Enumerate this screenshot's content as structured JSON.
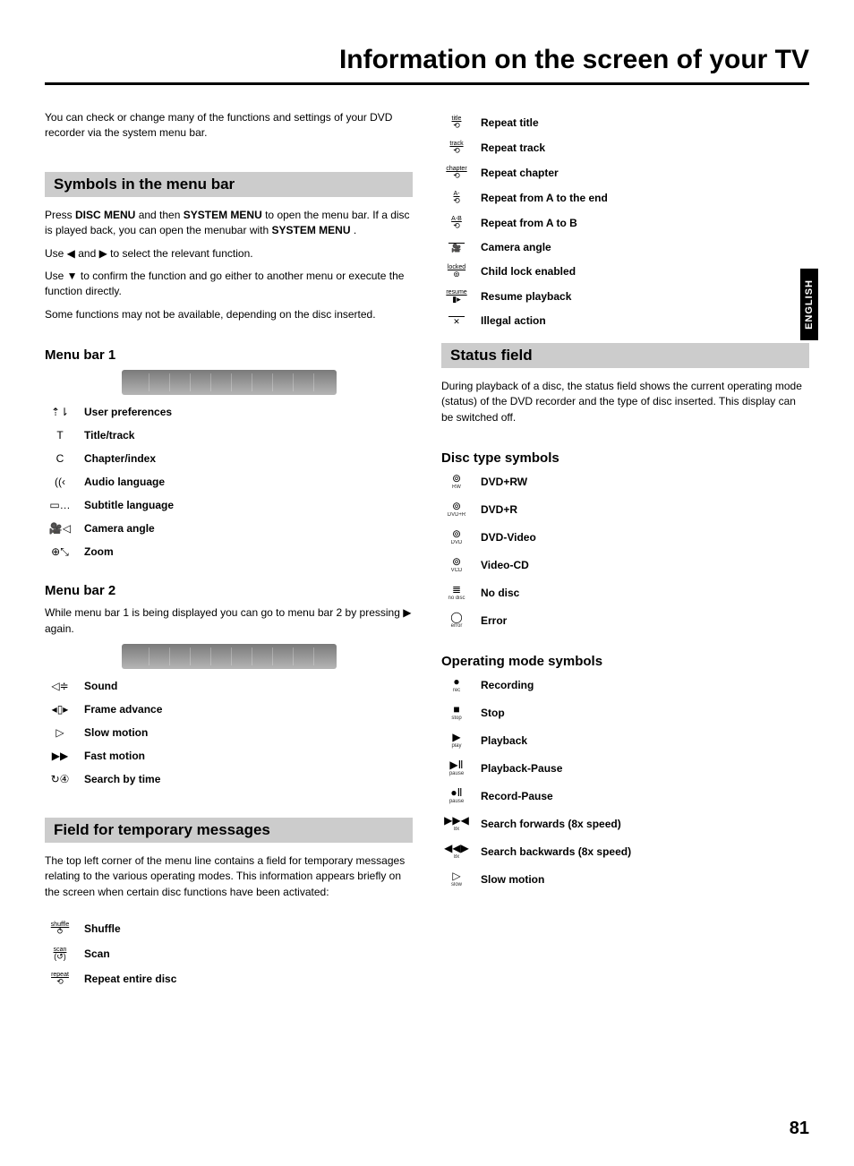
{
  "page_title": "Information on the screen of your TV",
  "side_tab": "ENGLISH",
  "page_number": "81",
  "intro": "You can check or change many of the functions and settings of your DVD recorder via the system menu bar.",
  "section_symbols_title": "Symbols in the menu bar",
  "symbols_para1_a": "Press ",
  "symbols_para1_b": " and then ",
  "symbols_para1_c": " to open the menu bar. If a disc is played back, you can open the menubar with ",
  "symbols_para1_d": " .",
  "kw_disc_menu": " DISC MENU",
  "kw_system_menu": " SYSTEM MENU",
  "kw_system_menu2": " SYSTEM MENU",
  "symbols_para2": "Use  ◀  and  ▶  to select the relevant function.",
  "symbols_para3": "Use  ▼  to confirm the function and go either to another menu or execute the function directly.",
  "symbols_para4": "Some functions may not be available, depending on the disc inserted.",
  "menu_bar1_heading": "Menu bar 1",
  "menu_bar1_items": [
    {
      "icon_top": "",
      "icon_glyph": "⇡⇂",
      "icon_sub": "",
      "label": "User preferences"
    },
    {
      "icon_top": "",
      "icon_glyph": "T",
      "icon_sub": "",
      "label": "Title/track"
    },
    {
      "icon_top": "",
      "icon_glyph": "C",
      "icon_sub": "",
      "label": "Chapter/index"
    },
    {
      "icon_top": "",
      "icon_glyph": "((‹",
      "icon_sub": "",
      "label": "Audio language"
    },
    {
      "icon_top": "",
      "icon_glyph": "▭…",
      "icon_sub": "",
      "label": "Subtitle language"
    },
    {
      "icon_top": "",
      "icon_glyph": "🎥◁",
      "icon_sub": "",
      "label": "Camera angle"
    },
    {
      "icon_top": "",
      "icon_glyph": "⊕⤡",
      "icon_sub": "",
      "label": "Zoom"
    }
  ],
  "menu_bar2_heading": "Menu bar 2",
  "menu_bar2_intro": "While menu bar 1 is being displayed you can go to menu bar 2 by pressing  ▶  again.",
  "menu_bar2_items": [
    {
      "icon_top": "",
      "icon_glyph": "◁≑",
      "icon_sub": "",
      "label": "Sound"
    },
    {
      "icon_top": "",
      "icon_glyph": "◂▯▸",
      "icon_sub": "",
      "label": "Frame advance"
    },
    {
      "icon_top": "",
      "icon_glyph": "▷",
      "icon_sub": "",
      "label": "Slow motion"
    },
    {
      "icon_top": "",
      "icon_glyph": "▶▶",
      "icon_sub": "",
      "label": "Fast motion"
    },
    {
      "icon_top": "",
      "icon_glyph": "↻④",
      "icon_sub": "",
      "label": "Search by time"
    }
  ],
  "field_temp_title": "Field for temporary messages",
  "field_temp_intro": "The top left corner of the menu line contains a field for temporary messages relating to the various operating modes. This information appears briefly on the screen when certain disc functions have been activated:",
  "temp_messages_left": [
    {
      "top": "shuffle",
      "bot": "⥀",
      "label": "Shuffle"
    },
    {
      "top": "scan",
      "bot": "(↺)",
      "label": "Scan"
    },
    {
      "top": "repeat",
      "bot": "⟲",
      "label": "Repeat entire disc"
    }
  ],
  "temp_messages_right": [
    {
      "top": "title",
      "bot": "⟲",
      "label": "Repeat title"
    },
    {
      "top": "track",
      "bot": "⟲",
      "label": "Repeat track"
    },
    {
      "top": "chapter",
      "bot": "⟲",
      "label": "Repeat chapter"
    },
    {
      "top": "A-",
      "bot": "⟲",
      "label": "Repeat from A to the end"
    },
    {
      "top": "A-B",
      "bot": "⟲",
      "label": "Repeat from A to B"
    },
    {
      "top": "",
      "bot": "🎥",
      "label": "Camera angle"
    },
    {
      "top": "locked",
      "bot": "⊚",
      "label": "Child lock enabled"
    },
    {
      "top": "resume",
      "bot": "▮▸",
      "label": "Resume playback"
    },
    {
      "top": "",
      "bot": "✕",
      "label": "Illegal action"
    }
  ],
  "status_field_title": "Status field",
  "status_field_intro": "During playback of a disc, the status field shows the current operating mode (status) of the DVD recorder and the type of disc inserted. This display can be switched off.",
  "disc_types_heading": "Disc type symbols",
  "disc_types": [
    {
      "icon_glyph": "⊚",
      "icon_sub": "RW",
      "label": "DVD+RW"
    },
    {
      "icon_glyph": "⊚",
      "icon_sub": "DVD+R",
      "label": "DVD+R"
    },
    {
      "icon_glyph": "⊚",
      "icon_sub": "DVD",
      "label": "DVD-Video"
    },
    {
      "icon_glyph": "⊚",
      "icon_sub": "VCD",
      "label": "Video-CD"
    },
    {
      "icon_glyph": "≣",
      "icon_sub": "no disc",
      "label": "No disc"
    },
    {
      "icon_glyph": "◯",
      "icon_sub": "error",
      "label": "Error"
    }
  ],
  "op_mode_heading": "Operating mode symbols",
  "op_modes": [
    {
      "icon_glyph": "●",
      "icon_sub": "rec",
      "label": "Recording"
    },
    {
      "icon_glyph": "■",
      "icon_sub": "stop",
      "label": "Stop"
    },
    {
      "icon_glyph": "▶",
      "icon_sub": "play",
      "label": "Playback"
    },
    {
      "icon_glyph": "▶Ⅱ",
      "icon_sub": "pause",
      "label": "Playback-Pause"
    },
    {
      "icon_glyph": "●Ⅱ",
      "icon_sub": "pause",
      "label": "Record-Pause"
    },
    {
      "icon_glyph": "▶▶◀",
      "icon_sub": "8x",
      "label": "Search forwards (8x speed)"
    },
    {
      "icon_glyph": "◀◀▶",
      "icon_sub": "8x",
      "label": "Search backwards (8x speed)"
    },
    {
      "icon_glyph": "▷",
      "icon_sub": "slow",
      "label": "Slow motion"
    }
  ]
}
